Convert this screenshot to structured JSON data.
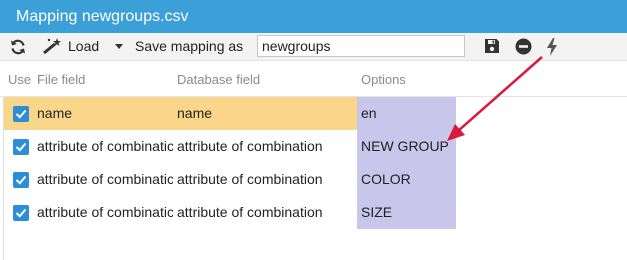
{
  "window": {
    "title": "Mapping newgroups.csv"
  },
  "toolbar": {
    "refresh_icon": "refresh-icon",
    "load_icon": "magic-wand-icon",
    "load_label": "Load",
    "dropdown_icon": "caret-down-icon",
    "save_mapping_label": "Save mapping as",
    "mapping_name_value": "newgroups",
    "save_icon": "floppy-disk-icon",
    "delete_icon": "minus-circle-icon",
    "run_icon": "lightning-bolt-icon"
  },
  "grid": {
    "columns": {
      "use": "Use",
      "file_field": "File field",
      "database_field": "Database field",
      "options": "Options"
    },
    "rows": [
      {
        "use": true,
        "file_field": "name",
        "database_field": "name",
        "options": "en",
        "selected": true
      },
      {
        "use": true,
        "file_field": "attribute of combinatic",
        "database_field": "attribute of combination",
        "options": "NEW GROUP",
        "selected": false
      },
      {
        "use": true,
        "file_field": "attribute of combinatic",
        "database_field": "attribute of combination",
        "options": "COLOR",
        "selected": false
      },
      {
        "use": true,
        "file_field": "attribute of combinatic",
        "database_field": "attribute of combination",
        "options": "SIZE",
        "selected": false
      }
    ]
  },
  "colors": {
    "title_bar": "#3ca0d8",
    "selected_row": "#fad68a",
    "options_cell": "#c8c6ea",
    "checkbox": "#2c8ed6",
    "annotation_arrow": "#d81b3c"
  }
}
